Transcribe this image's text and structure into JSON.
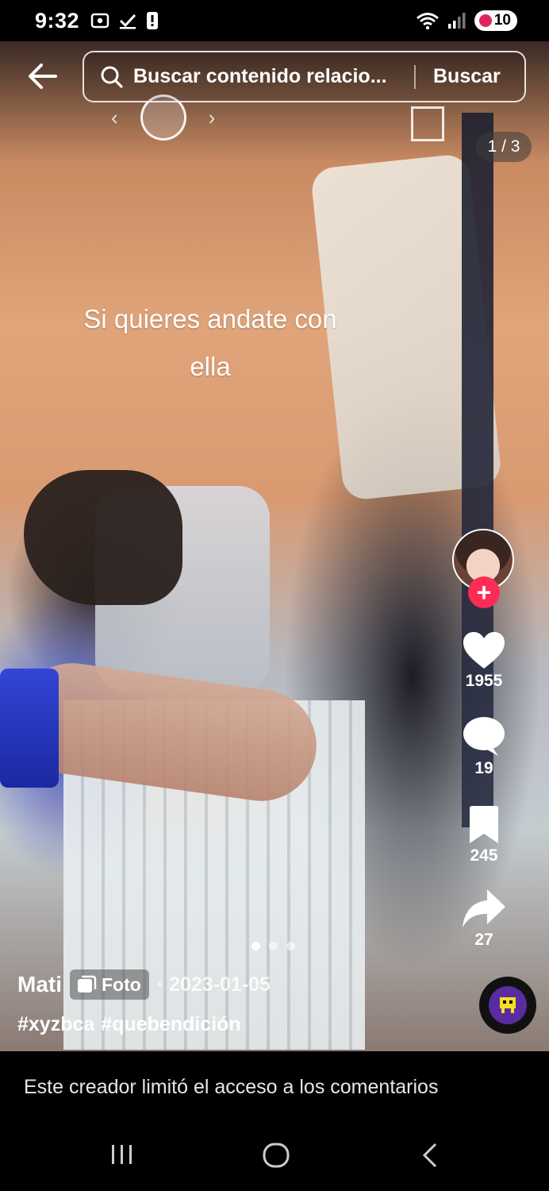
{
  "status_bar": {
    "time": "9:32",
    "battery": "10",
    "icons": [
      "screen-record-icon",
      "check-icon",
      "alert-icon",
      "wifi-icon",
      "signal-icon",
      "battery-icon"
    ]
  },
  "search": {
    "placeholder": "Buscar contenido relacio...",
    "button_label": "Buscar"
  },
  "post": {
    "page_counter": "1 / 3",
    "overlay_text_line1": "Si quieres andate con",
    "overlay_text_line2": "ella",
    "author": "Mati",
    "type_label": "Foto",
    "date": "· 2023-01-05",
    "hashtags": [
      "#xyzbca",
      "#quebendición"
    ],
    "current_slide": 1,
    "total_slides": 3
  },
  "actions": {
    "likes": "1955",
    "comments": "19",
    "saves": "245",
    "shares": "27"
  },
  "comments_notice": "Este creador limitó el acceso a los comentarios",
  "colors": {
    "follow_accent": "#fe2c55",
    "background": "#000000",
    "text": "#ffffff"
  }
}
